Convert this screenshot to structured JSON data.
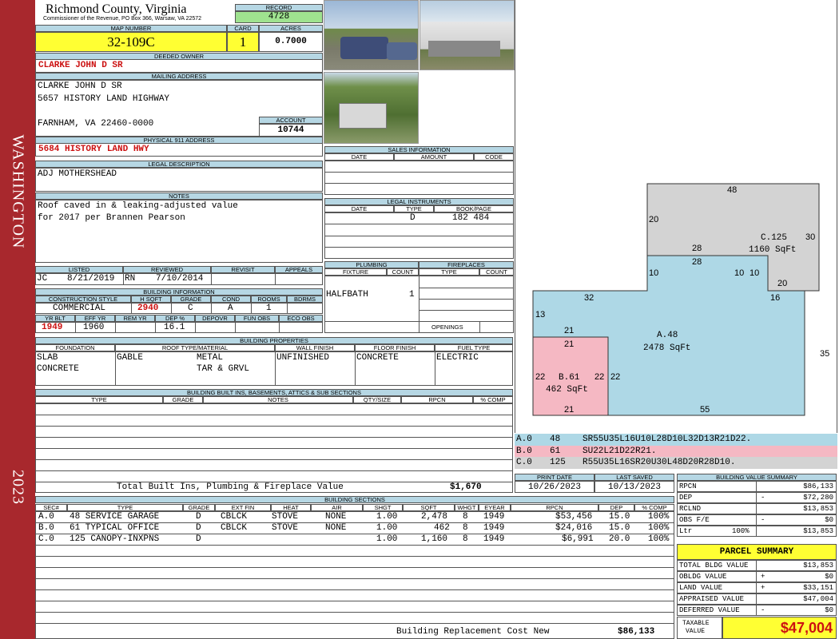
{
  "side": {
    "county": "WASHINGTON",
    "year": "2023"
  },
  "header": {
    "county": "Richmond County, Virginia",
    "commissioner": "Commissioner of the Revenue, PO Box 366, Warsaw, VA 22572",
    "record_label": "RECORD",
    "record": "4728",
    "map_label": "MAP NUMBER",
    "map": "32-109C",
    "card_label": "CARD",
    "card": "1",
    "acres_label": "ACRES",
    "acres": "0.7000"
  },
  "owner": {
    "label": "DEEDED OWNER",
    "value": "CLARKE JOHN D SR"
  },
  "mailing": {
    "label": "MAILING ADDRESS",
    "line1": "CLARKE JOHN D SR",
    "line2": "5657 HISTORY LAND HIGHWAY",
    "line3": "FARNHAM, VA 22460-0000",
    "account_label": "ACCOUNT",
    "account": "10744"
  },
  "physical": {
    "label": "PHYSICAL 911 ADDRESS",
    "value": "5684 HISTORY LAND HWY"
  },
  "legal": {
    "label": "LEGAL DESCRIPTION",
    "value": "ADJ MOTHERSHEAD"
  },
  "notes": {
    "label": "NOTES",
    "line1": "Roof caved in & leaking-adjusted value",
    "line2": "for 2017 per Brannen Pearson"
  },
  "sales": {
    "label": "SALES INFORMATION",
    "cols": [
      "DATE",
      "AMOUNT",
      "CODE"
    ]
  },
  "instruments": {
    "label": "LEGAL INSTRUMENTS",
    "cols": [
      "DATE",
      "TYPE",
      "BOOK/PAGE"
    ],
    "type": "D",
    "book": "182 484"
  },
  "plumbing": {
    "label": "PLUMBING",
    "cols": [
      "FIXTURE",
      "COUNT"
    ],
    "fixture": "HALFBATH",
    "count": "1"
  },
  "fireplaces": {
    "label": "FIREPLACES",
    "cols": [
      "TYPE",
      "COUNT"
    ],
    "openings": "OPENINGS"
  },
  "listed": {
    "listed_label": "LISTED",
    "reviewed_label": "REVIEWED",
    "revisit_label": "REVISIT",
    "appeals_label": "APPEALS",
    "lister": "JC",
    "listed_date": "8/21/2019",
    "reviewer": "RN",
    "reviewed_date": "7/10/2014"
  },
  "bldg_info": {
    "label": "BUILDING INFORMATION",
    "cols1": [
      "CONSTRUCTION STYLE",
      "H SQFT",
      "GRADE",
      "COND",
      "ROOMS",
      "BDRMS"
    ],
    "style": "COMMERCIAL",
    "hsqft": "2940",
    "grade": "C",
    "cond": "A",
    "rooms": "1",
    "bdrms": "",
    "cols2": [
      "YR BLT",
      "EFF YR",
      "REM YR",
      "DEP %",
      "DEPOVR",
      "FUN OBS",
      "ECO OBS"
    ],
    "yrblt": "1949",
    "effyr": "1960",
    "remyr": "",
    "dep": "16.1"
  },
  "props": {
    "label": "BUILDING PROPERTIES",
    "cols": [
      "FOUNDATION",
      "ROOF TYPE/MATERIAL",
      "WALL FINISH",
      "FLOOR FINISH",
      "FUEL TYPE"
    ],
    "found1": "SLAB",
    "found2": "CONCRETE",
    "roof1a": "GABLE",
    "roof1b": "METAL",
    "roof2b": "TAR & GRVL",
    "wall": "UNFINISHED",
    "floor": "CONCRETE",
    "fuel": "ELECTRIC"
  },
  "builtins": {
    "label": "BUILDING BUILT INS, BASEMENTS, ATTICS & SUB SECTIONS",
    "cols": [
      "TYPE",
      "GRADE",
      "NOTES",
      "QTY/SIZE",
      "RPCN",
      "% COMP"
    ],
    "total_label": "Total Built Ins, Plumbing & Fireplace Value",
    "total": "$1,670"
  },
  "dates": {
    "print_label": "PRINT DATE",
    "print": "10/26/2023",
    "saved_label": "LAST SAVED",
    "saved": "10/13/2023"
  },
  "sections": {
    "label": "BUILDING SECTIONS",
    "cols": [
      "SEC#",
      "TYPE",
      "GRADE",
      "EXT FIN",
      "HEAT",
      "AIR",
      "SHGT",
      "SQFT",
      "WHGT",
      "EYEAR",
      "RPCN",
      "DEP",
      "% COMP"
    ],
    "rows": [
      {
        "sec": "A.0",
        "type": "48 SERVICE GARAGE",
        "grade": "D",
        "ext": "CBLCK",
        "heat": "STOVE",
        "air": "NONE",
        "shgt": "1.00",
        "sqft": "2,478",
        "whgt": "8",
        "eyear": "1949",
        "rpcn": "$53,456",
        "dep": "15.0",
        "comp": "100%"
      },
      {
        "sec": "B.0",
        "type": "61 TYPICAL OFFICE",
        "grade": "D",
        "ext": "CBLCK",
        "heat": "STOVE",
        "air": "NONE",
        "shgt": "1.00",
        "sqft": "462",
        "whgt": "8",
        "eyear": "1949",
        "rpcn": "$24,016",
        "dep": "15.0",
        "comp": "100%"
      },
      {
        "sec": "C.0",
        "type": "125 CANOPY-INXPNS",
        "grade": "D",
        "ext": "",
        "heat": "",
        "air": "",
        "shgt": "1.00",
        "sqft": "1,160",
        "whgt": "8",
        "eyear": "1949",
        "rpcn": "$6,991",
        "dep": "20.0",
        "comp": "100%"
      }
    ],
    "rcn_label": "Building Replacement Cost New",
    "rcn": "$86,133"
  },
  "sketch": {
    "c_label": "C.125",
    "c_area": "1160 SqFt",
    "a_label": "A.48",
    "a_area": "2478 SqFt",
    "b_label": "B.61",
    "b_area": "462 SqFt",
    "dims": [
      "48",
      "20",
      "30",
      "28",
      "28",
      "10",
      "10",
      "10",
      "20",
      "32",
      "16",
      "13",
      "21",
      "21",
      "35",
      "22",
      "22",
      "22",
      "21",
      "55"
    ],
    "codes": [
      {
        "sec": "A.0",
        "num": "48",
        "code": "SR55U35L16U10L28D10L32D13R21D22."
      },
      {
        "sec": "B.0",
        "num": "61",
        "code": "SU22L21D22R21."
      },
      {
        "sec": "C.0",
        "num": "125",
        "code": "R55U35L16SR20U30L48D20R28D10."
      }
    ],
    "colors": {
      "a": "#aed8e6",
      "b": "#f5b8c3",
      "c": "#d3d3d3"
    }
  },
  "value_summary": {
    "label": "BUILDING VALUE SUMMARY",
    "rpcn_label": "RPCN",
    "rpcn": "$86,133",
    "dep_label": "DEP",
    "dep_sign": "-",
    "dep": "$72,280",
    "rclnd_label": "RCLND",
    "rclnd": "$13,853",
    "obs_label": "OBS F/E",
    "obs_sign": "-",
    "obs": "$0",
    "ltr_label": "Ltr",
    "ltr_pct": "100%",
    "ltr": "$13,853"
  },
  "parcel": {
    "label": "PARCEL SUMMARY",
    "total_bldg_label": "TOTAL BLDG VALUE",
    "total_bldg": "$13,853",
    "obldg_label": "OBLDG VALUE",
    "obldg_sign": "+",
    "obldg": "$0",
    "land_label": "LAND VALUE",
    "land_sign": "+",
    "land": "$33,151",
    "appraised_label": "APPRAISED VALUE",
    "appraised": "$47,004",
    "deferred_label": "DEFERRED VALUE",
    "deferred_sign": "-",
    "deferred": "$0",
    "taxable_label1": "TAXABLE",
    "taxable_label2": "VALUE",
    "taxable": "$47,004"
  }
}
